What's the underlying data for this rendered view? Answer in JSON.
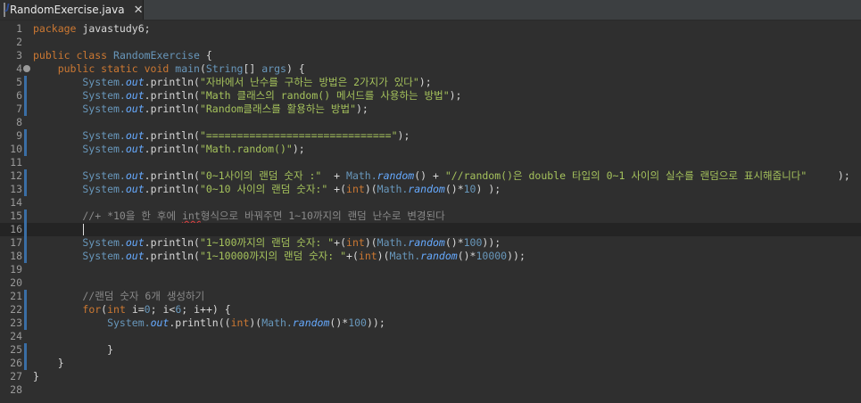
{
  "tab": {
    "filename": "RandomExercise.java",
    "icon": "java-file-icon",
    "close": "✕"
  },
  "editor": {
    "lines": [
      {
        "n": "1",
        "segs": [
          {
            "t": "package",
            "c": "kw"
          },
          {
            "t": " javastudy6;",
            "c": ""
          }
        ]
      },
      {
        "n": "2",
        "segs": []
      },
      {
        "n": "3",
        "segs": [
          {
            "t": "public class ",
            "c": "kw"
          },
          {
            "t": "RandomExercise",
            "c": "cls"
          },
          {
            "t": " {",
            "c": ""
          }
        ]
      },
      {
        "n": "4",
        "segs": [
          {
            "t": "    ",
            "c": ""
          },
          {
            "t": "public static void ",
            "c": "kw"
          },
          {
            "t": "main",
            "c": "cls"
          },
          {
            "t": "(",
            "c": ""
          },
          {
            "t": "String",
            "c": "cls"
          },
          {
            "t": "[] ",
            "c": ""
          },
          {
            "t": "args",
            "c": "cls"
          },
          {
            "t": ") {",
            "c": ""
          }
        ],
        "fold": true
      },
      {
        "n": "5",
        "segs": [
          {
            "t": "        System.",
            "c": "cls"
          },
          {
            "t": "out",
            "c": "fld"
          },
          {
            "t": ".println(",
            "c": ""
          },
          {
            "t": "\"자바에서 난수를 구하는 방법은 2가지가 있다\"",
            "c": "str"
          },
          {
            "t": ");",
            "c": ""
          }
        ]
      },
      {
        "n": "6",
        "segs": [
          {
            "t": "        System.",
            "c": "cls"
          },
          {
            "t": "out",
            "c": "fld"
          },
          {
            "t": ".println(",
            "c": ""
          },
          {
            "t": "\"Math 클래스의 random() 메서드를 사용하는 방법\"",
            "c": "str"
          },
          {
            "t": ");",
            "c": ""
          }
        ]
      },
      {
        "n": "7",
        "segs": [
          {
            "t": "        System.",
            "c": "cls"
          },
          {
            "t": "out",
            "c": "fld"
          },
          {
            "t": ".println(",
            "c": ""
          },
          {
            "t": "\"Random클래스를 활용하는 방법\"",
            "c": "str"
          },
          {
            "t": ");",
            "c": ""
          }
        ]
      },
      {
        "n": "8",
        "segs": []
      },
      {
        "n": "9",
        "segs": [
          {
            "t": "        System.",
            "c": "cls"
          },
          {
            "t": "out",
            "c": "fld"
          },
          {
            "t": ".println(",
            "c": ""
          },
          {
            "t": "\"==============================\"",
            "c": "str"
          },
          {
            "t": ");",
            "c": ""
          }
        ]
      },
      {
        "n": "10",
        "segs": [
          {
            "t": "        System.",
            "c": "cls"
          },
          {
            "t": "out",
            "c": "fld"
          },
          {
            "t": ".println(",
            "c": ""
          },
          {
            "t": "\"Math.random()\"",
            "c": "str"
          },
          {
            "t": ");",
            "c": ""
          }
        ]
      },
      {
        "n": "11",
        "segs": []
      },
      {
        "n": "12",
        "segs": [
          {
            "t": "        System.",
            "c": "cls"
          },
          {
            "t": "out",
            "c": "fld"
          },
          {
            "t": ".println(",
            "c": ""
          },
          {
            "t": "\"0~1사이의 랜덤 숫자 :\"",
            "c": "str"
          },
          {
            "t": "  + ",
            "c": ""
          },
          {
            "t": "Math.",
            "c": "cls"
          },
          {
            "t": "random",
            "c": "fld"
          },
          {
            "t": "() + ",
            "c": ""
          },
          {
            "t": "\"//random()은 double 타입의 0~1 사이의 실수를 랜덤으로 표시해줍니다\"",
            "c": "str"
          },
          {
            "t": "     );",
            "c": ""
          }
        ]
      },
      {
        "n": "13",
        "segs": [
          {
            "t": "        System.",
            "c": "cls"
          },
          {
            "t": "out",
            "c": "fld"
          },
          {
            "t": ".println(",
            "c": ""
          },
          {
            "t": "\"0~10 사이의 랜덤 숫자:\"",
            "c": "str"
          },
          {
            "t": " +(",
            "c": ""
          },
          {
            "t": "int",
            "c": "kw"
          },
          {
            "t": ")(",
            "c": ""
          },
          {
            "t": "Math.",
            "c": "cls"
          },
          {
            "t": "random",
            "c": "fld"
          },
          {
            "t": "()*",
            "c": ""
          },
          {
            "t": "10",
            "c": "num"
          },
          {
            "t": ") );",
            "c": ""
          }
        ]
      },
      {
        "n": "14",
        "segs": []
      },
      {
        "n": "15",
        "segs": [
          {
            "t": "        //+ *10을 한 후에 ",
            "c": "cmt"
          },
          {
            "t": "int",
            "c": "cmt err"
          },
          {
            "t": "형식으로 바꿔주면 1~10까지의 랜덤 난수로 변경된다",
            "c": "cmt"
          }
        ]
      },
      {
        "n": "16",
        "segs": [],
        "current": true
      },
      {
        "n": "17",
        "segs": [
          {
            "t": "        System.",
            "c": "cls"
          },
          {
            "t": "out",
            "c": "fld"
          },
          {
            "t": ".println(",
            "c": ""
          },
          {
            "t": "\"1~100까지의 랜덤 숫자: \"",
            "c": "str"
          },
          {
            "t": "+(",
            "c": ""
          },
          {
            "t": "int",
            "c": "kw"
          },
          {
            "t": ")(",
            "c": ""
          },
          {
            "t": "Math.",
            "c": "cls"
          },
          {
            "t": "random",
            "c": "fld"
          },
          {
            "t": "()*",
            "c": ""
          },
          {
            "t": "100",
            "c": "num"
          },
          {
            "t": "));",
            "c": ""
          }
        ]
      },
      {
        "n": "18",
        "segs": [
          {
            "t": "        System.",
            "c": "cls"
          },
          {
            "t": "out",
            "c": "fld"
          },
          {
            "t": ".println(",
            "c": ""
          },
          {
            "t": "\"1~10000까지의 랜덤 숫자: \"",
            "c": "str"
          },
          {
            "t": "+(",
            "c": ""
          },
          {
            "t": "int",
            "c": "kw"
          },
          {
            "t": ")(",
            "c": ""
          },
          {
            "t": "Math.",
            "c": "cls"
          },
          {
            "t": "random",
            "c": "fld"
          },
          {
            "t": "()*",
            "c": ""
          },
          {
            "t": "10000",
            "c": "num"
          },
          {
            "t": "));",
            "c": ""
          }
        ]
      },
      {
        "n": "19",
        "segs": []
      },
      {
        "n": "20",
        "segs": []
      },
      {
        "n": "21",
        "segs": [
          {
            "t": "        //랜덤 숫자 6개 생성하기",
            "c": "cmt"
          }
        ]
      },
      {
        "n": "22",
        "segs": [
          {
            "t": "        ",
            "c": ""
          },
          {
            "t": "for",
            "c": "kw"
          },
          {
            "t": "(",
            "c": ""
          },
          {
            "t": "int",
            "c": "kw"
          },
          {
            "t": " i=",
            "c": ""
          },
          {
            "t": "0",
            "c": "num"
          },
          {
            "t": "; i<",
            "c": ""
          },
          {
            "t": "6",
            "c": "num"
          },
          {
            "t": "; i++) {",
            "c": ""
          }
        ]
      },
      {
        "n": "23",
        "segs": [
          {
            "t": "            System.",
            "c": "cls"
          },
          {
            "t": "out",
            "c": "fld"
          },
          {
            "t": ".println((",
            "c": ""
          },
          {
            "t": "int",
            "c": "kw"
          },
          {
            "t": ")(",
            "c": ""
          },
          {
            "t": "Math.",
            "c": "cls"
          },
          {
            "t": "random",
            "c": "fld"
          },
          {
            "t": "()*",
            "c": ""
          },
          {
            "t": "100",
            "c": "num"
          },
          {
            "t": "));",
            "c": ""
          }
        ]
      },
      {
        "n": "24",
        "segs": []
      },
      {
        "n": "25",
        "segs": [
          {
            "t": "            }",
            "c": ""
          }
        ]
      },
      {
        "n": "26",
        "segs": [
          {
            "t": "    }",
            "c": ""
          }
        ]
      },
      {
        "n": "27",
        "segs": [
          {
            "t": "}",
            "c": ""
          }
        ]
      },
      {
        "n": "28",
        "segs": []
      }
    ]
  }
}
